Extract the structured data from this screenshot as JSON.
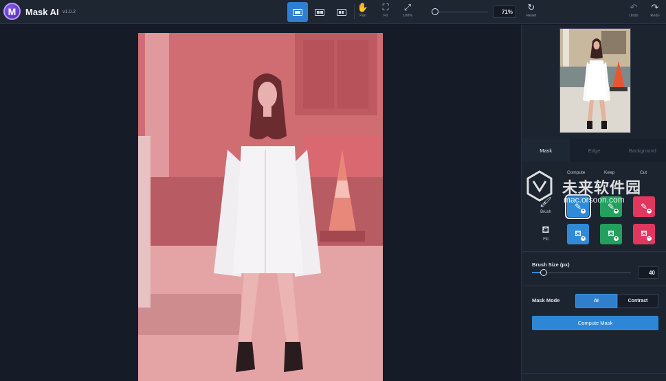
{
  "app": {
    "title": "Mask AI",
    "version": "v1.0.2",
    "logo_letter": "M"
  },
  "toolbar": {
    "view_modes": [
      {
        "name": "single-view",
        "active": true
      },
      {
        "name": "split-view",
        "active": false
      },
      {
        "name": "side-by-side-view",
        "active": false
      }
    ],
    "pan_label": "Pan",
    "fit_label": "Fit",
    "zoom100_label": "100%",
    "zoom_value": "71%",
    "reset_label": "Reset",
    "undo_label": "Undo",
    "redo_label": "Redo"
  },
  "panel": {
    "tabs": [
      {
        "label": "Mask",
        "active": true
      },
      {
        "label": "Edge",
        "active": false
      },
      {
        "label": "Background",
        "active": false
      }
    ],
    "columns": {
      "compute": "Compute",
      "keep": "Keep",
      "cut": "Cut"
    },
    "rows": {
      "brush": "Brush",
      "fill": "Fill"
    },
    "brush_size_label": "Brush Size (px)",
    "brush_size_value": "40",
    "mask_mode_label": "Mask Mode",
    "mask_mode_options": {
      "ai": "AI",
      "contrast": "Contrast"
    },
    "compute_button": "Compute Mask"
  },
  "watermark": {
    "title": "未来软件园",
    "url": "mac.orsoon.com"
  },
  "colors": {
    "accent": "#2f8ad8",
    "compute": "#2f8ad8",
    "keep": "#24a05e",
    "cut": "#e0375f",
    "mask_overlay": "#d57a80"
  }
}
